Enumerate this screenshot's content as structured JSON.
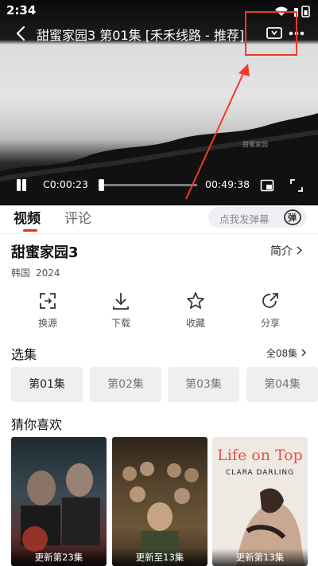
{
  "status_bar": {
    "time": "2:34"
  },
  "player": {
    "title": "甜蜜家园3 第01集 [禾禾线路 - 推荐]",
    "current_time": "C0:00:23",
    "duration": "00:49:38",
    "watermark": "甜蜜家园",
    "progress_fraction": 0.008
  },
  "tabs": {
    "video": "视频",
    "comment": "评论"
  },
  "danmaku": {
    "placeholder": "点我发弹幕",
    "icon_text": "弹"
  },
  "show": {
    "title": "甜蜜家园3",
    "intro_label": "简介",
    "region": "韩国",
    "year": "2024"
  },
  "actions": [
    {
      "label": "换源",
      "icon": "switch-source-icon"
    },
    {
      "label": "下载",
      "icon": "download-icon"
    },
    {
      "label": "收藏",
      "icon": "star-icon"
    },
    {
      "label": "分享",
      "icon": "share-icon"
    }
  ],
  "episodes": {
    "heading": "选集",
    "all_label": "全08集",
    "items": [
      "第01集",
      "第02集",
      "第03集",
      "第04集"
    ],
    "selected": 0
  },
  "recommend": {
    "heading": "猜你喜欢",
    "items": [
      {
        "caption": "更新第23集"
      },
      {
        "caption": "更新至13集"
      },
      {
        "caption": "更新第13集",
        "poster_title": "Life on Top",
        "poster_subtitle": "CLARA DARLING"
      }
    ]
  },
  "colors": {
    "accent": "#e0302d",
    "annotation": "#f0392b"
  }
}
